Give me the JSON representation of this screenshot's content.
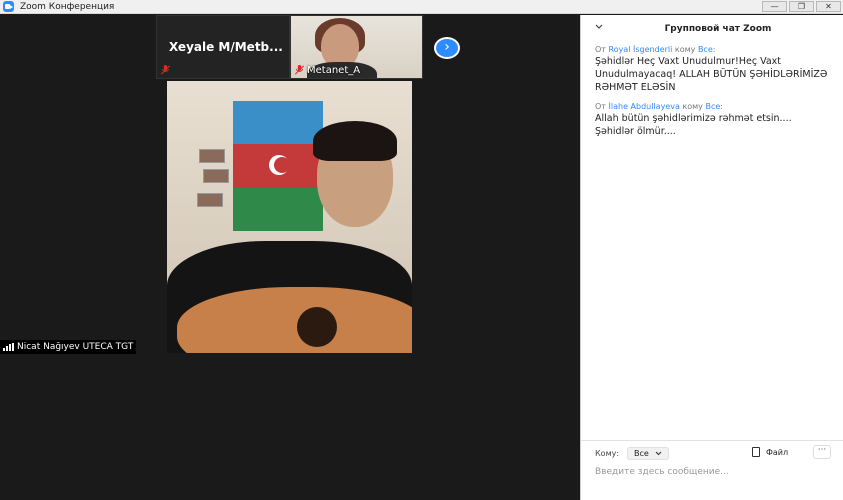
{
  "window": {
    "title": "Zoom Конференция",
    "controls": {
      "minimize": "—",
      "restore": "❐",
      "close": "✕"
    }
  },
  "gallery": {
    "tiles": [
      {
        "name": "Xeyale  M/Metb...",
        "muted": true
      },
      {
        "name": "Metanet_A",
        "muted": true
      }
    ],
    "next_icon": "chevron-right-icon"
  },
  "active_speaker": {
    "name": "Nicat Nağıyev UTECA TGT"
  },
  "chat": {
    "title": "Групповой чат Zoom",
    "messages": [
      {
        "from_prefix": "От",
        "sender": "Royal İsgenderli",
        "to_prefix": "кому",
        "recipient": "Все:",
        "text": "Şəhidlər Heç Vaxt Unudulmur!Heç Vaxt Unudulmayacaq! ALLAH BÜTÜN ŞƏHİDLƏRİMİZƏ RƏHMƏT ELƏSİN"
      },
      {
        "from_prefix": "От",
        "sender": "İlahe Abdullayeva",
        "to_prefix": "кому",
        "recipient": "Все:",
        "text": "Allah bütün şəhidlərimizə rəhmət etsin.... Şəhidlər ölmür...."
      }
    ],
    "to_label": "Кому:",
    "to_value": "Все",
    "file_label": "Файл",
    "more_label": "···",
    "input_placeholder": "Введите здесь сообщение..."
  },
  "colors": {
    "accent": "#2d8cff",
    "background": "#1a1a1a",
    "mute_red": "#e02828"
  }
}
